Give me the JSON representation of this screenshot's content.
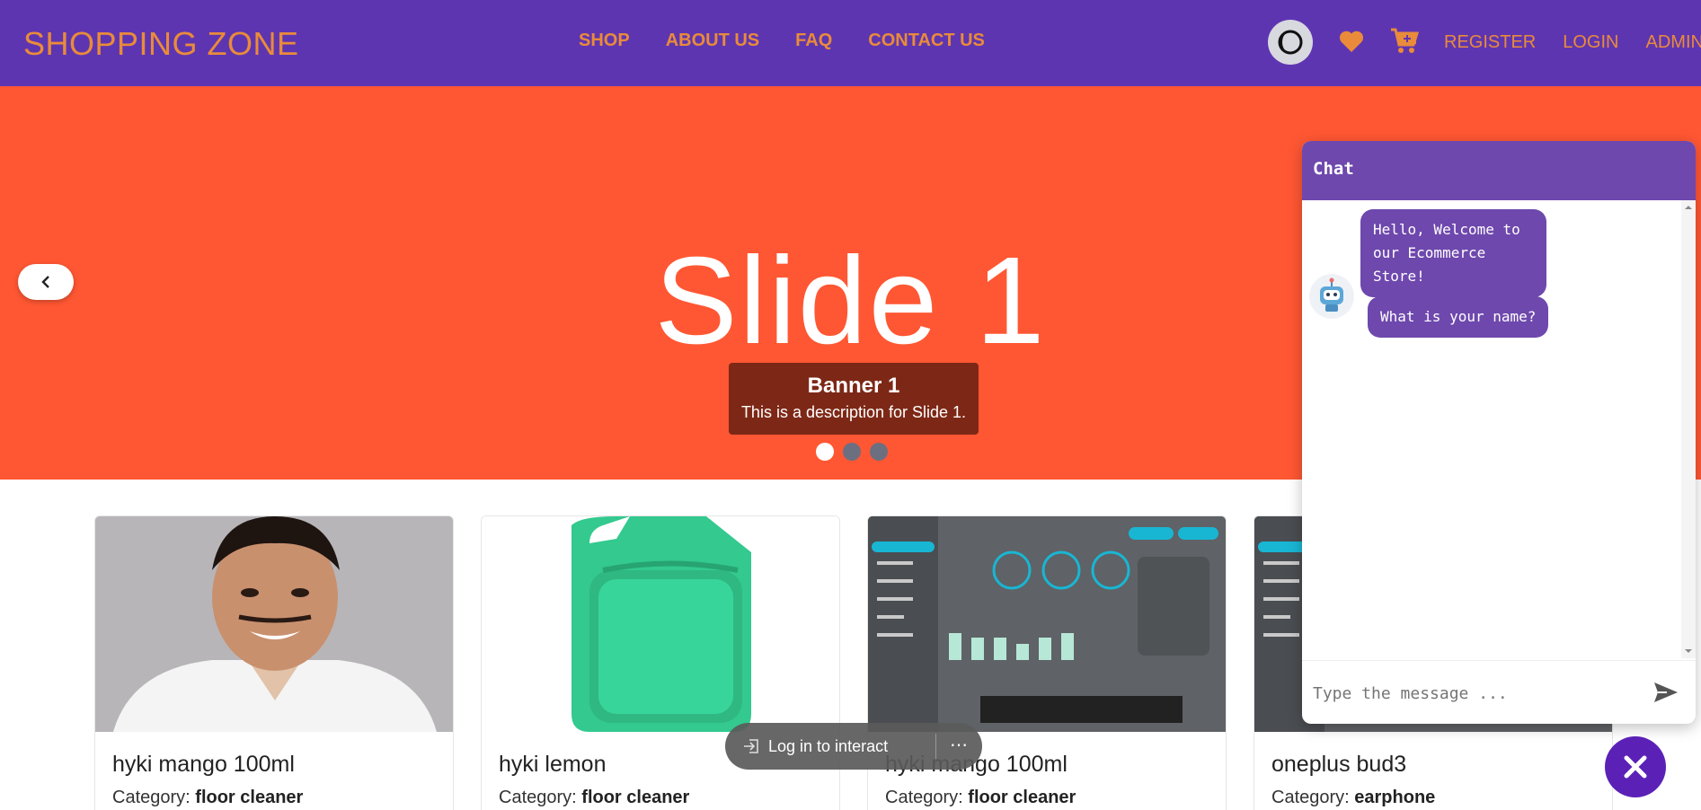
{
  "navbar": {
    "brand": "SHOPPING ZONE",
    "links": [
      "SHOP",
      "ABOUT US",
      "FAQ",
      "CONTACT US"
    ],
    "right_links": [
      "REGISTER",
      "LOGIN",
      "ADMIN"
    ],
    "accent_color": "#e98b3a",
    "bg_color": "#5e35b1"
  },
  "hero": {
    "slide_title": "Slide 1",
    "caption_title": "Banner 1",
    "caption_desc": "This is a description for Slide 1.",
    "bg_color": "#ff5733",
    "dots": 3,
    "active_dot": 0
  },
  "products": [
    {
      "name": "hyki mango 100ml",
      "category_label": "Category:",
      "category": "floor cleaner",
      "image": "person-photo"
    },
    {
      "name": "hyki lemon",
      "category_label": "Category:",
      "category": "floor cleaner",
      "image": "green-bottle"
    },
    {
      "name": "hyki mango 100ml",
      "category_label": "Category:",
      "category": "floor cleaner",
      "image": "typing-test-screenshot"
    },
    {
      "name": "oneplus bud3",
      "category_label": "Category:",
      "category": "earphone",
      "image": "typing-test-screenshot"
    }
  ],
  "chat": {
    "title": "Chat",
    "messages": [
      "Hello, Welcome to our Ecommerce Store!",
      "What is your name?"
    ],
    "input_placeholder": "Type the message ..."
  },
  "login_pill": {
    "label": "Log in to interact",
    "more": "⋯"
  }
}
